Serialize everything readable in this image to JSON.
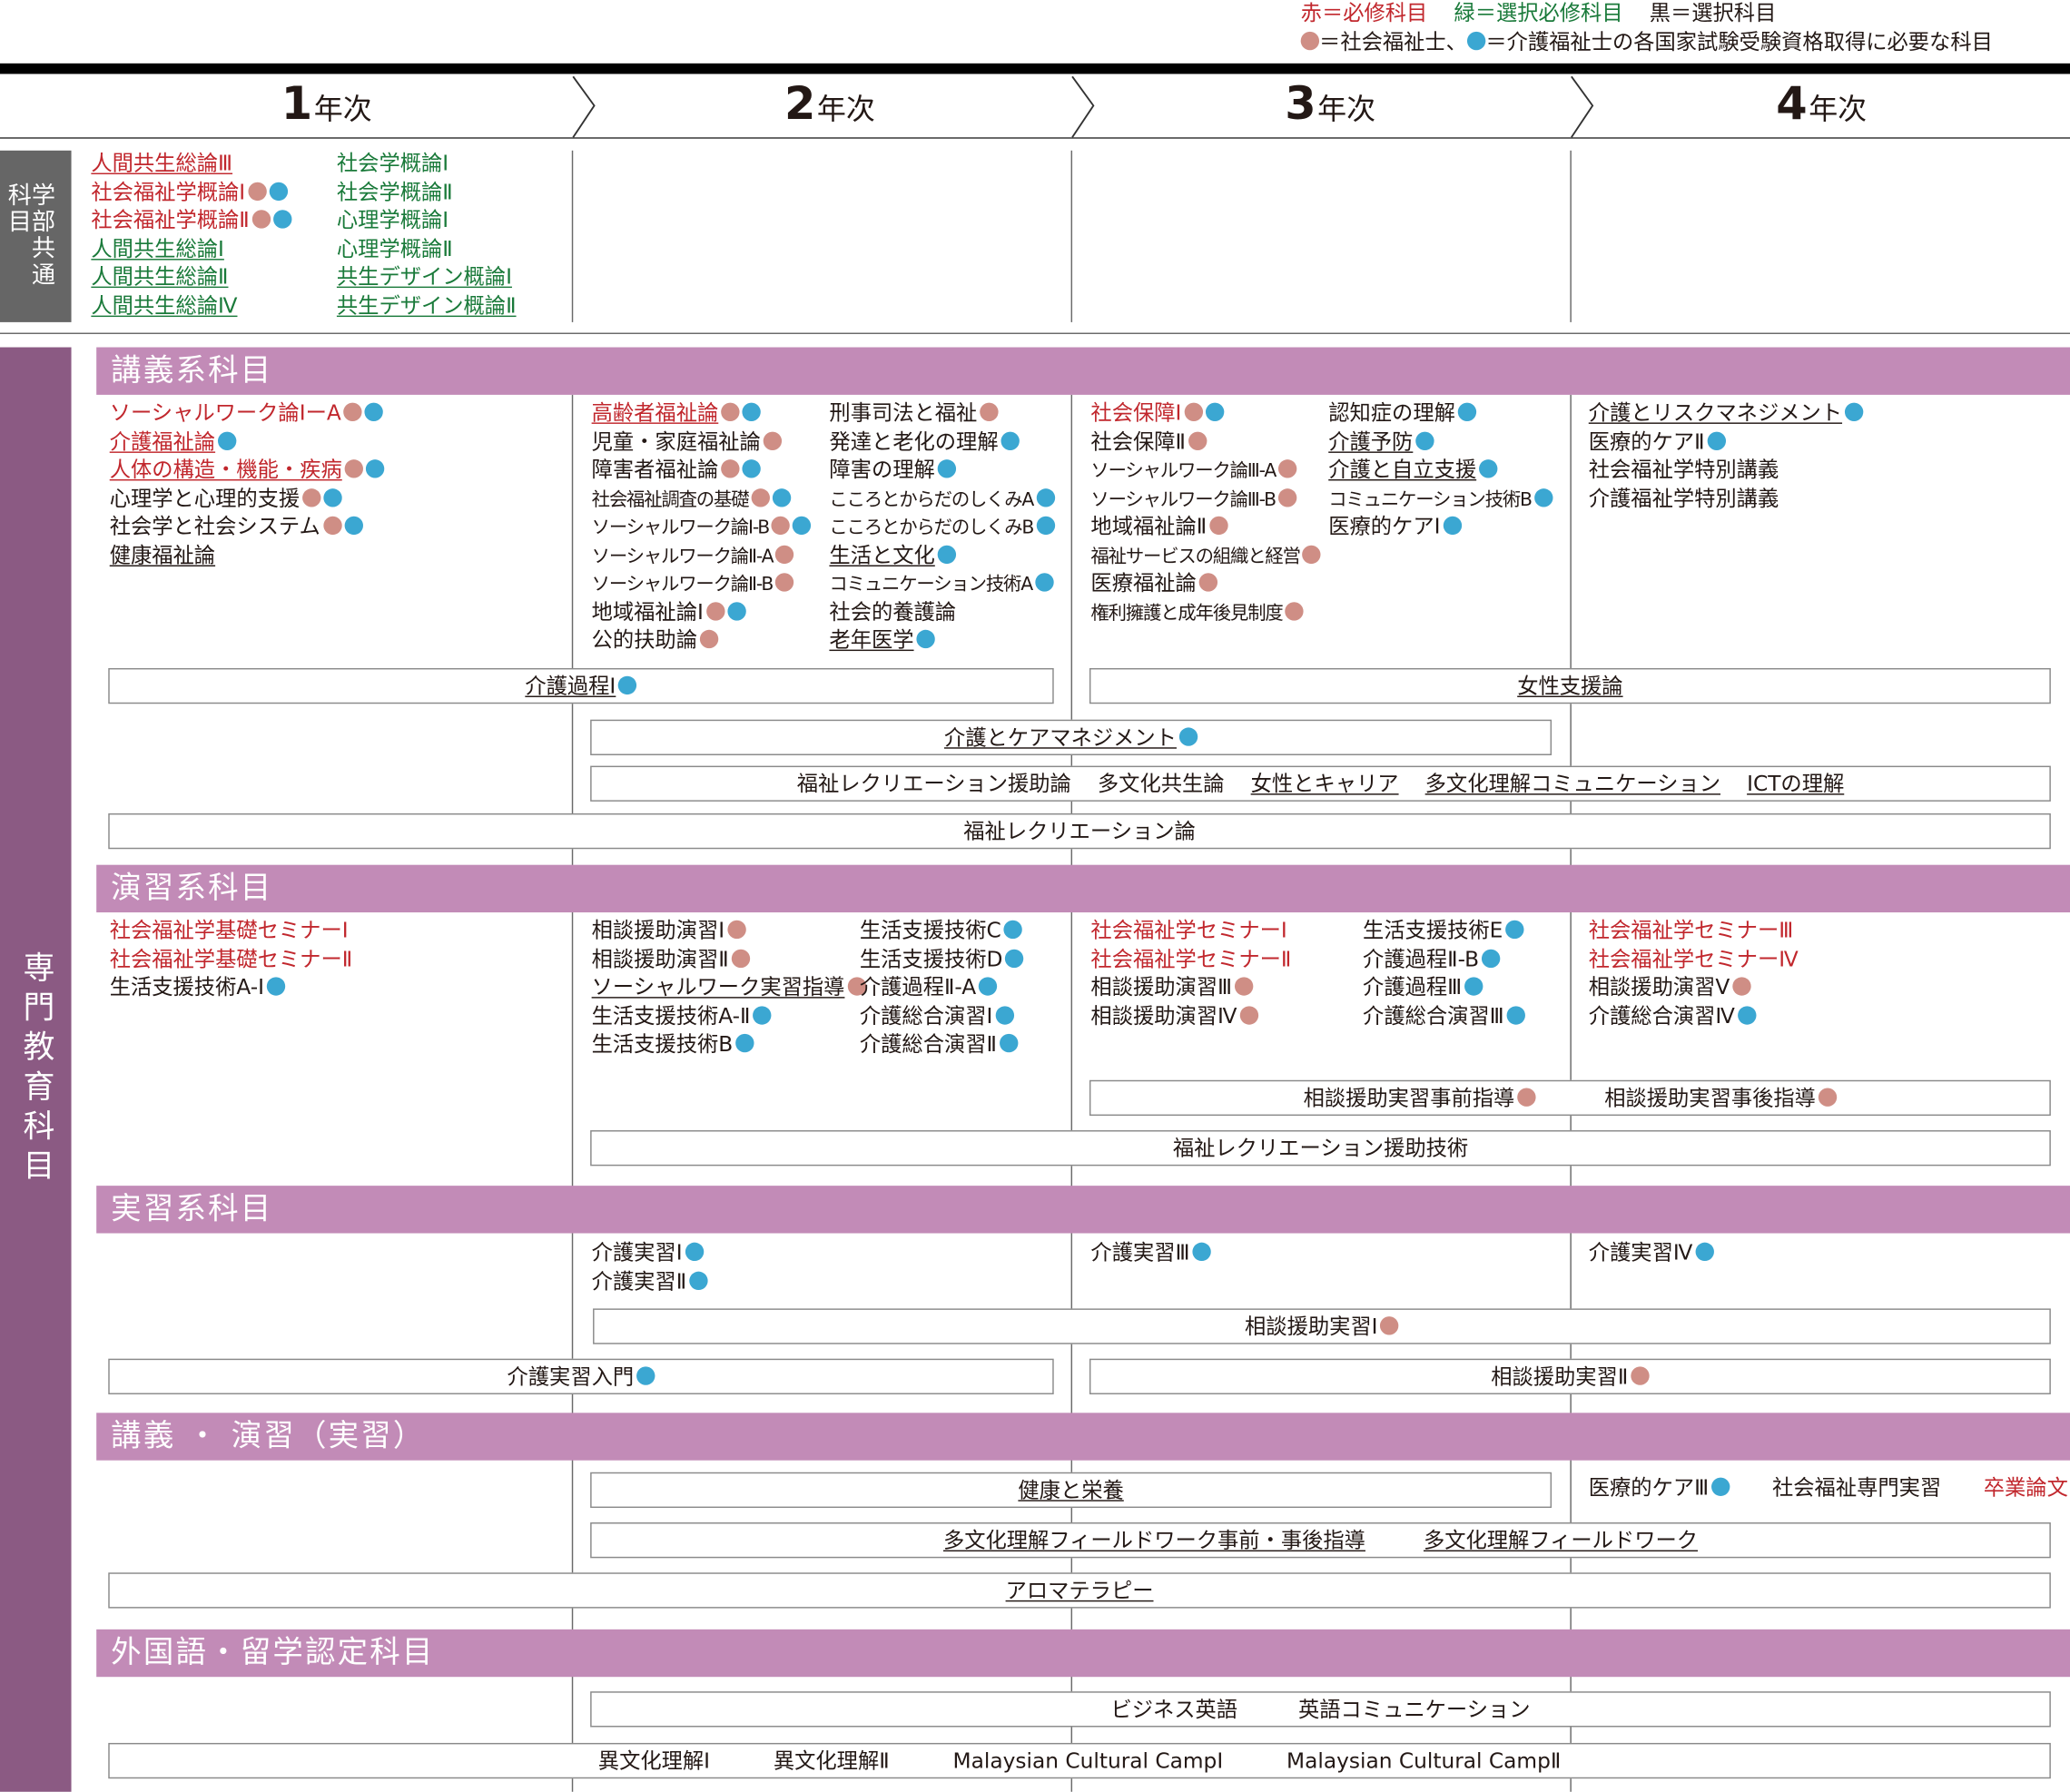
{
  "legend": {
    "line1": [
      {
        "text": "赤＝必修科目",
        "color": "red"
      },
      {
        "text": "緑＝選択必修科目",
        "color": "grn"
      },
      {
        "text": "黒＝選択科目",
        "color": "blk"
      }
    ],
    "line2_a": "＝社会福祉士、",
    "line2_b": "＝介護福祉士の各国家試験受験資格取得に必要な科目"
  },
  "years": [
    {
      "num": "1",
      "label": "年次"
    },
    {
      "num": "2",
      "label": "年次"
    },
    {
      "num": "3",
      "label": "年次"
    },
    {
      "num": "4",
      "label": "年次"
    }
  ],
  "faculty_common": {
    "label_lines": [
      "科学",
      "目部",
      "　共",
      "　通"
    ],
    "columns": [
      [
        {
          "t": "人間共生総論Ⅲ",
          "c": "red",
          "u": true
        },
        {
          "t": "社会福祉学概論Ⅰ",
          "c": "red",
          "d": [
            "p",
            "b"
          ]
        },
        {
          "t": "社会福祉学概論Ⅱ",
          "c": "red",
          "d": [
            "p",
            "b"
          ]
        },
        {
          "t": "人間共生総論Ⅰ",
          "c": "grn",
          "u": true
        },
        {
          "t": "人間共生総論Ⅱ",
          "c": "grn",
          "u": true
        },
        {
          "t": "人間共生総論Ⅳ",
          "c": "grn",
          "u": true
        }
      ],
      [
        {
          "t": "社会学概論Ⅰ",
          "c": "grn"
        },
        {
          "t": "社会学概論Ⅱ",
          "c": "grn"
        },
        {
          "t": "心理学概論Ⅰ",
          "c": "grn"
        },
        {
          "t": "心理学概論Ⅱ",
          "c": "grn"
        },
        {
          "t": "共生デザイン概論Ⅰ",
          "c": "grn",
          "u": true
        },
        {
          "t": "共生デザイン概論Ⅱ",
          "c": "grn",
          "u": true
        }
      ]
    ]
  },
  "specialized_label": "専門教育科目",
  "lecture": {
    "title": "講義系科目",
    "columns": [
      [
        {
          "t": "ソーシャルワーク論ⅠーA",
          "c": "red",
          "d": [
            "p",
            "b"
          ]
        },
        {
          "t": "介護福祉論",
          "c": "red",
          "u": true,
          "d": [
            "b"
          ]
        },
        {
          "t": "人体の構造・機能・疾病",
          "c": "red",
          "u": true,
          "d": [
            "p",
            "b"
          ]
        },
        {
          "t": "心理学と心理的支援",
          "c": "blk",
          "d": [
            "p",
            "b"
          ]
        },
        {
          "t": "社会学と社会システム",
          "c": "blk",
          "d": [
            "p",
            "b"
          ]
        },
        {
          "t": "健康福祉論",
          "c": "blk",
          "u": true
        }
      ],
      [
        {
          "t": "高齢者福祉論",
          "c": "red",
          "u": true,
          "d": [
            "p",
            "b"
          ]
        },
        {
          "t": "児童・家庭福祉論",
          "c": "blk",
          "d": [
            "p"
          ]
        },
        {
          "t": "障害者福祉論",
          "c": "blk",
          "d": [
            "p",
            "b"
          ]
        },
        {
          "t": "社会福祉調査の基礎",
          "c": "blk",
          "sm": true,
          "d": [
            "p",
            "b"
          ]
        },
        {
          "t": "ソーシャルワーク論Ⅰ-B",
          "c": "blk",
          "sm": true,
          "d": [
            "p",
            "b"
          ]
        },
        {
          "t": "ソーシャルワーク論Ⅱ-A",
          "c": "blk",
          "sm": true,
          "d": [
            "p"
          ]
        },
        {
          "t": "ソーシャルワーク論Ⅱ-B",
          "c": "blk",
          "sm": true,
          "d": [
            "p"
          ]
        },
        {
          "t": "地域福祉論Ⅰ",
          "c": "blk",
          "d": [
            "p",
            "b"
          ]
        },
        {
          "t": "公的扶助論",
          "c": "blk",
          "d": [
            "p"
          ]
        }
      ],
      [
        {
          "t": "刑事司法と福祉",
          "c": "blk",
          "d": [
            "p"
          ]
        },
        {
          "t": "発達と老化の理解",
          "c": "blk",
          "d": [
            "b"
          ]
        },
        {
          "t": "障害の理解",
          "c": "blk",
          "d": [
            "b"
          ]
        },
        {
          "t": "こころとからだのしくみA",
          "c": "blk",
          "sm": true,
          "d": [
            "b"
          ]
        },
        {
          "t": "こころとからだのしくみB",
          "c": "blk",
          "sm": true,
          "d": [
            "b"
          ]
        },
        {
          "t": "生活と文化",
          "c": "blk",
          "u": true,
          "d": [
            "b"
          ]
        },
        {
          "t": "コミュニケーション技術A",
          "c": "blk",
          "sm": true,
          "d": [
            "b"
          ]
        },
        {
          "t": "社会的養護論",
          "c": "blk"
        },
        {
          "t": "老年医学",
          "c": "blk",
          "u": true,
          "d": [
            "b"
          ]
        }
      ],
      [
        {
          "t": "社会保障Ⅰ",
          "c": "red",
          "d": [
            "p",
            "b"
          ]
        },
        {
          "t": "社会保障Ⅱ",
          "c": "blk",
          "d": [
            "p"
          ]
        },
        {
          "t": "ソーシャルワーク論Ⅲ-A",
          "c": "blk",
          "sm": true,
          "d": [
            "p"
          ]
        },
        {
          "t": "ソーシャルワーク論Ⅲ-B",
          "c": "blk",
          "sm": true,
          "d": [
            "p"
          ]
        },
        {
          "t": "地域福祉論Ⅱ",
          "c": "blk",
          "d": [
            "p"
          ]
        },
        {
          "t": "福祉サービスの組織と経営",
          "c": "blk",
          "sm": true,
          "d": [
            "p"
          ]
        },
        {
          "t": "医療福祉論",
          "c": "blk",
          "d": [
            "p"
          ]
        },
        {
          "t": "権利擁護と成年後見制度",
          "c": "blk",
          "sm": true,
          "d": [
            "p"
          ]
        }
      ],
      [
        {
          "t": "認知症の理解",
          "c": "blk",
          "d": [
            "b"
          ]
        },
        {
          "t": "介護予防",
          "c": "blk",
          "u": true,
          "d": [
            "b"
          ]
        },
        {
          "t": "介護と自立支援",
          "c": "blk",
          "u": true,
          "d": [
            "b"
          ]
        },
        {
          "t": "コミュニケーション技術B",
          "c": "blk",
          "sm": true,
          "d": [
            "b"
          ]
        },
        {
          "t": "医療的ケアⅠ",
          "c": "blk",
          "d": [
            "b"
          ]
        }
      ],
      [
        {
          "t": "介護とリスクマネジメント",
          "c": "blk",
          "u": true,
          "d": [
            "b"
          ]
        },
        {
          "t": "医療的ケアⅡ",
          "c": "blk",
          "d": [
            "b"
          ]
        },
        {
          "t": "社会福祉学特別講義",
          "c": "blk"
        },
        {
          "t": "介護福祉学特別講義",
          "c": "blk"
        }
      ]
    ],
    "boxes": [
      {
        "items": [
          {
            "t": "介護過程Ⅰ",
            "u": true,
            "d": [
              "b"
            ]
          }
        ]
      },
      {
        "items": [
          {
            "t": "女性支援論",
            "u": true
          }
        ]
      },
      {
        "items": [
          {
            "t": "介護とケアマネジメント",
            "u": true,
            "d": [
              "b"
            ]
          }
        ]
      },
      {
        "items": [
          {
            "t": "福祉レクリエーション援助論"
          },
          {
            "t": "多文化共生論"
          },
          {
            "t": "女性とキャリア",
            "u": true
          },
          {
            "t": "多文化理解コミュニケーション",
            "u": true
          },
          {
            "t": "ICTの理解",
            "u": true
          }
        ]
      },
      {
        "items": [
          {
            "t": "福祉レクリエーション論"
          }
        ]
      }
    ]
  },
  "seminar": {
    "title": "演習系科目",
    "columns": [
      [
        {
          "t": "社会福祉学基礎セミナーⅠ",
          "c": "red"
        },
        {
          "t": "社会福祉学基礎セミナーⅡ",
          "c": "red"
        },
        {
          "t": "生活支援技術A-Ⅰ",
          "c": "blk",
          "d": [
            "b"
          ]
        }
      ],
      [
        {
          "t": "相談援助演習Ⅰ",
          "c": "blk",
          "d": [
            "p"
          ]
        },
        {
          "t": "相談援助演習Ⅱ",
          "c": "blk",
          "d": [
            "p"
          ]
        },
        {
          "t": "ソーシャルワーク実習指導",
          "c": "blk",
          "u": true,
          "d": [
            "p"
          ]
        },
        {
          "t": "生活支援技術A-Ⅱ",
          "c": "blk",
          "d": [
            "b"
          ]
        },
        {
          "t": "生活支援技術B",
          "c": "blk",
          "d": [
            "b"
          ]
        }
      ],
      [
        {
          "t": "生活支援技術C",
          "c": "blk",
          "d": [
            "b"
          ]
        },
        {
          "t": "生活支援技術D",
          "c": "blk",
          "d": [
            "b"
          ]
        },
        {
          "t": "介護過程Ⅱ-A",
          "c": "blk",
          "d": [
            "b"
          ]
        },
        {
          "t": "介護総合演習Ⅰ",
          "c": "blk",
          "d": [
            "b"
          ]
        },
        {
          "t": "介護総合演習Ⅱ",
          "c": "blk",
          "d": [
            "b"
          ]
        }
      ],
      [
        {
          "t": "社会福祉学セミナーⅠ",
          "c": "red"
        },
        {
          "t": "社会福祉学セミナーⅡ",
          "c": "red"
        },
        {
          "t": "相談援助演習Ⅲ",
          "c": "blk",
          "d": [
            "p"
          ]
        },
        {
          "t": "相談援助演習Ⅳ",
          "c": "blk",
          "d": [
            "p"
          ]
        }
      ],
      [
        {
          "t": "生活支援技術E",
          "c": "blk",
          "d": [
            "b"
          ]
        },
        {
          "t": "介護過程Ⅱ-B",
          "c": "blk",
          "d": [
            "b"
          ]
        },
        {
          "t": "介護過程Ⅲ",
          "c": "blk",
          "d": [
            "b"
          ]
        },
        {
          "t": "介護総合演習Ⅲ",
          "c": "blk",
          "d": [
            "b"
          ]
        }
      ],
      [
        {
          "t": "社会福祉学セミナーⅢ",
          "c": "red"
        },
        {
          "t": "社会福祉学セミナーⅣ",
          "c": "red"
        },
        {
          "t": "相談援助演習Ⅴ",
          "c": "blk",
          "d": [
            "p"
          ]
        },
        {
          "t": "介護総合演習Ⅳ",
          "c": "blk",
          "d": [
            "b"
          ]
        }
      ]
    ],
    "boxes": [
      {
        "items": [
          {
            "t": "相談援助実習事前指導",
            "d": [
              "p"
            ]
          },
          {
            "t": "相談援助実習事後指導",
            "d": [
              "p"
            ]
          }
        ]
      },
      {
        "items": [
          {
            "t": "福祉レクリエーション援助技術"
          }
        ]
      }
    ]
  },
  "practicum": {
    "title": "実習系科目",
    "columns": [
      [
        {
          "t": "介護実習Ⅰ",
          "c": "blk",
          "d": [
            "b"
          ]
        },
        {
          "t": "介護実習Ⅱ",
          "c": "blk",
          "d": [
            "b"
          ]
        }
      ],
      [
        {
          "t": "介護実習Ⅲ",
          "c": "blk",
          "d": [
            "b"
          ]
        }
      ],
      [
        {
          "t": "介護実習Ⅳ",
          "c": "blk",
          "d": [
            "b"
          ]
        }
      ]
    ],
    "boxes": [
      {
        "items": [
          {
            "t": "相談援助実習Ⅰ",
            "d": [
              "p"
            ]
          }
        ]
      },
      {
        "items": [
          {
            "t": "介護実習入門",
            "d": [
              "b"
            ]
          }
        ]
      },
      {
        "items": [
          {
            "t": "相談援助実習Ⅱ",
            "d": [
              "p"
            ]
          }
        ]
      }
    ]
  },
  "mixed": {
    "title": "講義 ・ 演習（実習）",
    "year4_items": [
      {
        "t": "医療的ケアⅢ",
        "c": "blk",
        "d": [
          "b"
        ]
      },
      {
        "t": "社会福祉専門実習",
        "c": "blk"
      },
      {
        "t": "卒業論文",
        "c": "red"
      }
    ],
    "boxes": [
      {
        "items": [
          {
            "t": "健康と栄養",
            "u": true
          }
        ]
      },
      {
        "items": [
          {
            "t": "多文化理解フィールドワーク事前・事後指導",
            "u": true
          },
          {
            "t": "多文化理解フィールドワーク",
            "u": true
          }
        ]
      },
      {
        "items": [
          {
            "t": "アロマテラピー",
            "u": true
          }
        ]
      }
    ]
  },
  "foreign": {
    "title": "外国語・留学認定科目",
    "boxes": [
      {
        "items": [
          {
            "t": "ビジネス英語"
          },
          {
            "t": "英語コミュニケーション"
          }
        ]
      },
      {
        "items": [
          {
            "t": "異文化理解Ⅰ"
          },
          {
            "t": "異文化理解Ⅱ"
          },
          {
            "t": "Malaysian Cultural CampⅠ"
          },
          {
            "t": "Malaysian Cultural CampⅡ"
          }
        ]
      }
    ]
  },
  "colors": {
    "red": "#c1272d",
    "green": "#1a7a3a",
    "black": "#231815",
    "band": "#c28bb7",
    "side": "#8b5a83",
    "dot_sw": "#cf8e85",
    "dot_cw": "#3ba7d2"
  }
}
